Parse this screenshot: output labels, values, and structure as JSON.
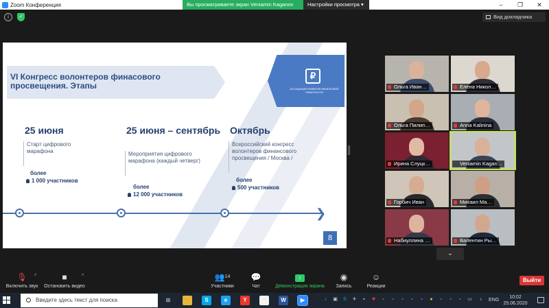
{
  "window": {
    "title": "Zoom Конференция",
    "share_banner": "Вы просматриваете экран Veniamin Kaganov",
    "view_options": "Настройки просмотра",
    "view_options_icon": "chevron-down-icon",
    "gallery_view_btn": "Вид докладчика"
  },
  "slide": {
    "title": "VI Конгресс волонтеров финасового просвещения. Этапы",
    "logo_mark": "₽",
    "logo_text": "Ассоциация развития финансовой грамотности",
    "columns": [
      {
        "date": "25 июня",
        "desc": "Старт цифрового марафона",
        "count_label": "более",
        "count_value": "1 000 участников"
      },
      {
        "date": "25 июня – сентябрь",
        "desc": "Мероприятия цифрового марафона (каждый четверг)",
        "count_label": "более",
        "count_value": "12 000 участников"
      },
      {
        "date": "Октябрь",
        "desc": "Всероссийский конгресс волонтеров финансового просвещения / Москва /",
        "count_label": "более",
        "count_value": "500 участников"
      }
    ],
    "page_number": "8"
  },
  "gallery": {
    "participants": [
      {
        "name": "Ольга Иван…",
        "bg": "#b7b4ae",
        "skin": "#d9b49b",
        "cloth": "#3c4c6a",
        "muted": true
      },
      {
        "name": "Елена Никол…",
        "bg": "#dcd8cf",
        "skin": "#d8a98e",
        "cloth": "#2f2f38",
        "muted": true
      },
      {
        "name": "Ольга Пилип…",
        "bg": "#c9c0b2",
        "skin": "#d3a68a",
        "cloth": "#4b3a30",
        "muted": true
      },
      {
        "name": "Anna Kalinina",
        "bg": "#a8aeb3",
        "skin": "#e0b59c",
        "cloth": "#2a2f3a",
        "muted": true
      },
      {
        "name": "Ирина Слуцк…",
        "bg": "#7a2030",
        "skin": "#e2b9a2",
        "cloth": "#2e2a33",
        "muted": true
      },
      {
        "name": "Veniamin Kagan…",
        "bg": "#c2c6c8",
        "skin": "#d9b09a",
        "cloth": "#3a4356",
        "muted": false,
        "active": true
      },
      {
        "name": "Горбич Иван",
        "bg": "#cfc5b8",
        "skin": "#d6ac92",
        "cloth": "#28292e",
        "muted": true
      },
      {
        "name": "Михаил Ма…",
        "bg": "#b8b0a6",
        "skin": "#cf9e86",
        "cloth": "#2d2e33",
        "muted": true
      },
      {
        "name": "Набиуллина …",
        "bg": "#8a3a46",
        "skin": "#dcb59e",
        "cloth": "#343a4a",
        "muted": true
      },
      {
        "name": "Валентин Ры…",
        "bg": "#b9bec2",
        "skin": "#d3a78e",
        "cloth": "#1f2a3d",
        "muted": true
      }
    ],
    "more_icon": "chevron-down-icon"
  },
  "toolbar": {
    "mute_label": "Включить звук",
    "mute_icon": "microphone-muted-icon",
    "video_label": "Остановить видео",
    "video_icon": "video-camera-icon",
    "participants_label": "Участники",
    "participants_count": "14",
    "participants_icon": "participants-icon",
    "chat_label": "Чат",
    "chat_icon": "chat-icon",
    "share_label": "Демонстрация экрана",
    "share_icon": "share-screen-icon",
    "record_label": "Запись",
    "record_icon": "record-icon",
    "reactions_label": "Реакции",
    "reactions_icon": "emoji-icon",
    "leave_label": "Выйти"
  },
  "taskbar": {
    "search_placeholder": "Введите здесь текст для поиска",
    "lang": "ENG",
    "time": "10:02",
    "date": "25.06.2020"
  },
  "colors": {
    "zoom_blue": "#2d8cff",
    "share_green": "#27ae60",
    "leave_red": "#d93636",
    "slide_blue": "#4a7ac4",
    "active_speaker": "#c6e84a"
  }
}
